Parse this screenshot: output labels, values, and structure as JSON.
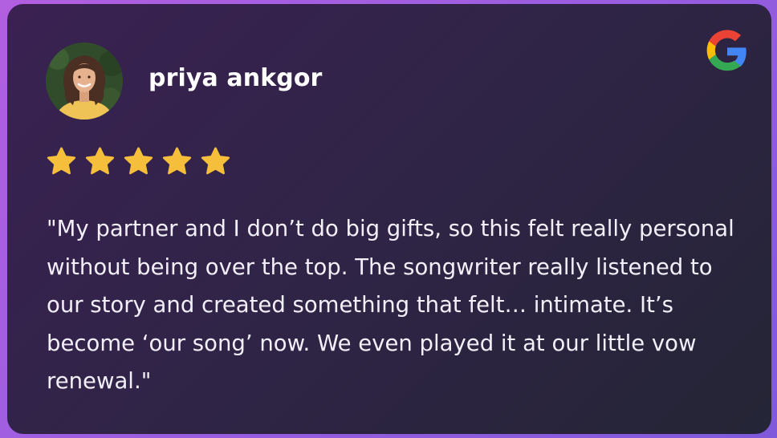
{
  "review": {
    "reviewer_name": "priya ankgor",
    "avatar_icon": "avatar-portrait",
    "source_icon": "google-g-logo",
    "rating": 5,
    "rating_max": 5,
    "text": "\"My partner and I don’t do big gifts, so this felt really personal without being over the top. The songwriter really listened to our story and created something that felt… intimate. It’s become ‘our song’ now. We even played it at our little vow renewal.\""
  },
  "colors": {
    "star": "#f6bf3b",
    "name": "#ffffff",
    "text": "#f2eff8",
    "card_start": "#3a2152",
    "card_end": "#242535",
    "border": "#a35edf"
  }
}
